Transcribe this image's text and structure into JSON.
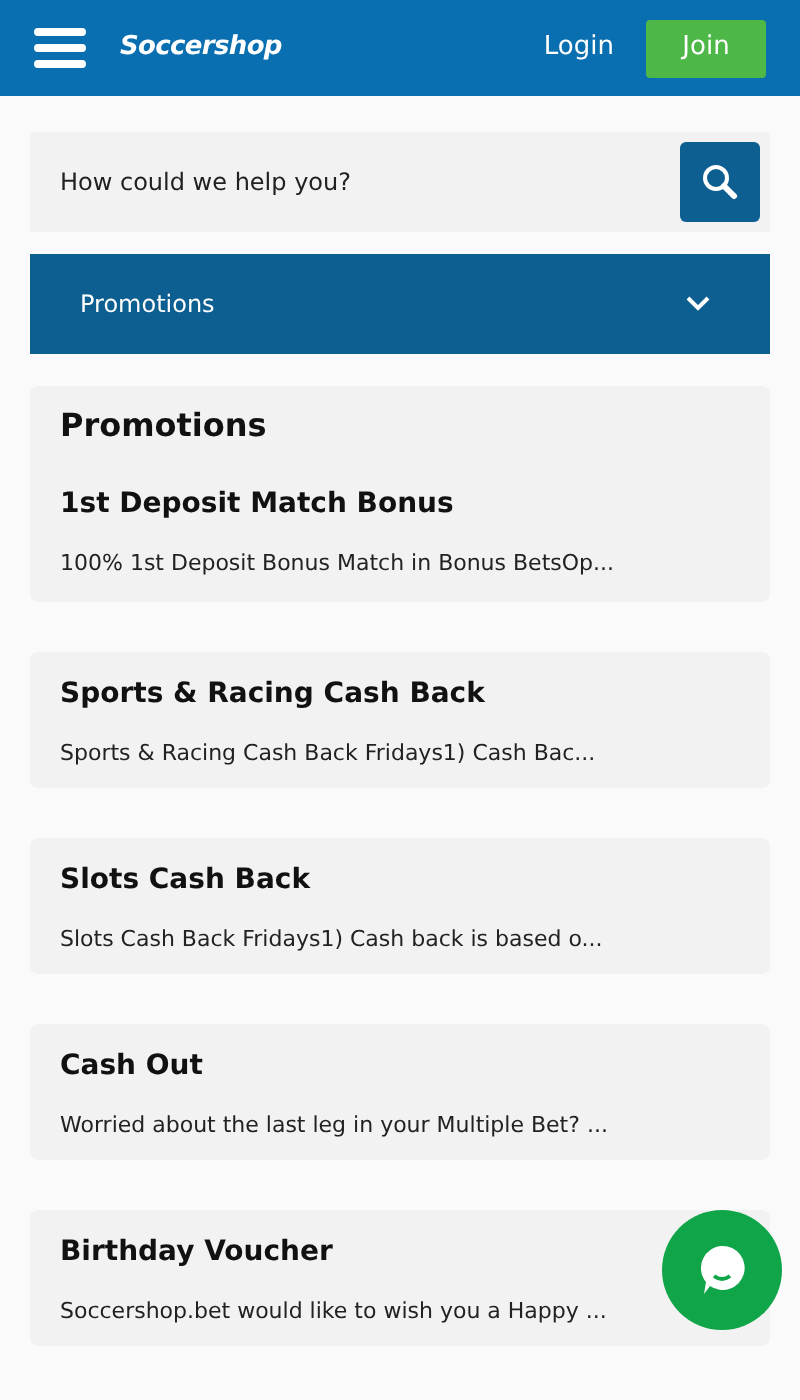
{
  "header": {
    "logo": "Soccershop",
    "login": "Login",
    "join": "Join"
  },
  "search": {
    "placeholder": "How could we help you?"
  },
  "dropdown": {
    "label": "Promotions",
    "expanded": false
  },
  "section_title": "Promotions",
  "promotions": [
    {
      "title": "1st Deposit Match Bonus",
      "summary": "100% 1st Deposit Bonus Match in Bonus BetsOp..."
    },
    {
      "title": "Sports & Racing Cash Back",
      "summary": "Sports & Racing Cash Back Fridays1) Cash Bac..."
    },
    {
      "title": "Slots Cash Back",
      "summary": "Slots Cash Back Fridays1) Cash back is based o..."
    },
    {
      "title": "Cash Out",
      "summary": "Worried about the last leg in your Multiple Bet? ..."
    },
    {
      "title": "Birthday Voucher",
      "summary": "Soccershop.bet would like to wish you a Happy ..."
    }
  ]
}
